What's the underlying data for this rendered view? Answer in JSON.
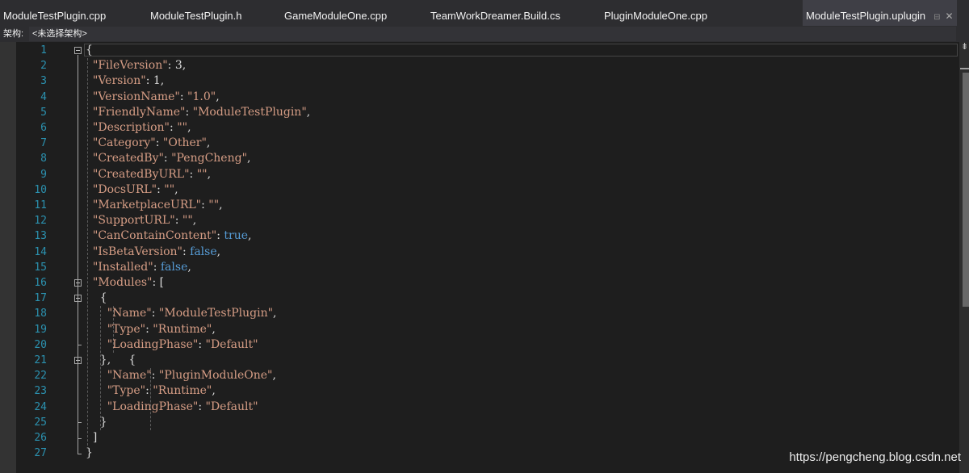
{
  "tabs": [
    {
      "label": "ModuleTestPlugin.cpp",
      "active": false
    },
    {
      "label": "ModuleTestPlugin.h",
      "active": false
    },
    {
      "label": "GameModuleOne.cpp",
      "active": false
    },
    {
      "label": "TeamWorkDreamer.Build.cs",
      "active": false
    },
    {
      "label": "PluginModuleOne.cpp",
      "active": false
    },
    {
      "label": "ModuleTestPlugin.uplugin",
      "active": true
    }
  ],
  "tab_icons": {
    "pin": "pin-icon",
    "close": "close-icon"
  },
  "navbar": {
    "label": "架构:",
    "value": "<未选择架构>"
  },
  "editor": {
    "line_numbers": [
      "1",
      "2",
      "3",
      "4",
      "5",
      "6",
      "7",
      "8",
      "9",
      "10",
      "11",
      "12",
      "13",
      "14",
      "15",
      "16",
      "17",
      "18",
      "19",
      "20",
      "21",
      "22",
      "23",
      "24",
      "25",
      "26",
      "27"
    ],
    "lines": [
      [
        {
          "t": "{",
          "c": "p"
        }
      ],
      [
        {
          "t": "  ",
          "c": "p"
        },
        {
          "t": "\"FileVersion\"",
          "c": "s"
        },
        {
          "t": ": 3,",
          "c": "p"
        }
      ],
      [
        {
          "t": "  ",
          "c": "p"
        },
        {
          "t": "\"Version\"",
          "c": "s"
        },
        {
          "t": ": 1,",
          "c": "p"
        }
      ],
      [
        {
          "t": "  ",
          "c": "p"
        },
        {
          "t": "\"VersionName\"",
          "c": "s"
        },
        {
          "t": ": ",
          "c": "p"
        },
        {
          "t": "\"1.0\"",
          "c": "s"
        },
        {
          "t": ",",
          "c": "p"
        }
      ],
      [
        {
          "t": "  ",
          "c": "p"
        },
        {
          "t": "\"FriendlyName\"",
          "c": "s"
        },
        {
          "t": ": ",
          "c": "p"
        },
        {
          "t": "\"ModuleTestPlugin\"",
          "c": "s"
        },
        {
          "t": ",",
          "c": "p"
        }
      ],
      [
        {
          "t": "  ",
          "c": "p"
        },
        {
          "t": "\"Description\"",
          "c": "s"
        },
        {
          "t": ": ",
          "c": "p"
        },
        {
          "t": "\"\"",
          "c": "s"
        },
        {
          "t": ",",
          "c": "p"
        }
      ],
      [
        {
          "t": "  ",
          "c": "p"
        },
        {
          "t": "\"Category\"",
          "c": "s"
        },
        {
          "t": ": ",
          "c": "p"
        },
        {
          "t": "\"Other\"",
          "c": "s"
        },
        {
          "t": ",",
          "c": "p"
        }
      ],
      [
        {
          "t": "  ",
          "c": "p"
        },
        {
          "t": "\"CreatedBy\"",
          "c": "s"
        },
        {
          "t": ": ",
          "c": "p"
        },
        {
          "t": "\"PengCheng\"",
          "c": "s"
        },
        {
          "t": ",",
          "c": "p"
        }
      ],
      [
        {
          "t": "  ",
          "c": "p"
        },
        {
          "t": "\"CreatedByURL\"",
          "c": "s"
        },
        {
          "t": ": ",
          "c": "p"
        },
        {
          "t": "\"\"",
          "c": "s"
        },
        {
          "t": ",",
          "c": "p"
        }
      ],
      [
        {
          "t": "  ",
          "c": "p"
        },
        {
          "t": "\"DocsURL\"",
          "c": "s"
        },
        {
          "t": ": ",
          "c": "p"
        },
        {
          "t": "\"\"",
          "c": "s"
        },
        {
          "t": ",",
          "c": "p"
        }
      ],
      [
        {
          "t": "  ",
          "c": "p"
        },
        {
          "t": "\"MarketplaceURL\"",
          "c": "s"
        },
        {
          "t": ": ",
          "c": "p"
        },
        {
          "t": "\"\"",
          "c": "s"
        },
        {
          "t": ",",
          "c": "p"
        }
      ],
      [
        {
          "t": "  ",
          "c": "p"
        },
        {
          "t": "\"SupportURL\"",
          "c": "s"
        },
        {
          "t": ": ",
          "c": "p"
        },
        {
          "t": "\"\"",
          "c": "s"
        },
        {
          "t": ",",
          "c": "p"
        }
      ],
      [
        {
          "t": "  ",
          "c": "p"
        },
        {
          "t": "\"CanContainContent\"",
          "c": "s"
        },
        {
          "t": ": ",
          "c": "p"
        },
        {
          "t": "true",
          "c": "k"
        },
        {
          "t": ",",
          "c": "p"
        }
      ],
      [
        {
          "t": "  ",
          "c": "p"
        },
        {
          "t": "\"IsBetaVersion\"",
          "c": "s"
        },
        {
          "t": ": ",
          "c": "p"
        },
        {
          "t": "false",
          "c": "k"
        },
        {
          "t": ",",
          "c": "p"
        }
      ],
      [
        {
          "t": "  ",
          "c": "p"
        },
        {
          "t": "\"Installed\"",
          "c": "s"
        },
        {
          "t": ": ",
          "c": "p"
        },
        {
          "t": "false",
          "c": "k"
        },
        {
          "t": ",",
          "c": "p"
        }
      ],
      [
        {
          "t": "  ",
          "c": "p"
        },
        {
          "t": "\"Modules\"",
          "c": "s"
        },
        {
          "t": ": [",
          "c": "p"
        }
      ],
      [
        {
          "t": "    {",
          "c": "p"
        }
      ],
      [
        {
          "t": "      ",
          "c": "p"
        },
        {
          "t": "\"Name\"",
          "c": "s"
        },
        {
          "t": ": ",
          "c": "p"
        },
        {
          "t": "\"ModuleTestPlugin\"",
          "c": "s"
        },
        {
          "t": ",",
          "c": "p"
        }
      ],
      [
        {
          "t": "      ",
          "c": "p"
        },
        {
          "t": "\"Type\"",
          "c": "s"
        },
        {
          "t": ": ",
          "c": "p"
        },
        {
          "t": "\"Runtime\"",
          "c": "s"
        },
        {
          "t": ",",
          "c": "p"
        }
      ],
      [
        {
          "t": "      ",
          "c": "p"
        },
        {
          "t": "\"LoadingPhase\"",
          "c": "s"
        },
        {
          "t": ": ",
          "c": "p"
        },
        {
          "t": "\"Default\"",
          "c": "s"
        }
      ],
      [
        {
          "t": "    },     {",
          "c": "p"
        }
      ],
      [
        {
          "t": "      ",
          "c": "p"
        },
        {
          "t": "\"Name\"",
          "c": "s"
        },
        {
          "t": ": ",
          "c": "p"
        },
        {
          "t": "\"PluginModuleOne\"",
          "c": "s"
        },
        {
          "t": ",",
          "c": "p"
        }
      ],
      [
        {
          "t": "      ",
          "c": "p"
        },
        {
          "t": "\"Type\"",
          "c": "s"
        },
        {
          "t": ": ",
          "c": "p"
        },
        {
          "t": "\"Runtime\"",
          "c": "s"
        },
        {
          "t": ",",
          "c": "p"
        }
      ],
      [
        {
          "t": "      ",
          "c": "p"
        },
        {
          "t": "\"LoadingPhase\"",
          "c": "s"
        },
        {
          "t": ": ",
          "c": "p"
        },
        {
          "t": "\"Default\"",
          "c": "s"
        }
      ],
      [
        {
          "t": "    }",
          "c": "p"
        }
      ],
      [
        {
          "t": "  ]",
          "c": "p"
        }
      ],
      [
        {
          "t": "}",
          "c": "p"
        }
      ]
    ]
  },
  "watermark": "https://pengcheng.blog.csdn.net",
  "colors": {
    "background": "#1e1e1e",
    "plain": "#dcdcdc",
    "string": "#d69d85",
    "keyword": "#569cd6",
    "line_number": "#2b91af"
  }
}
